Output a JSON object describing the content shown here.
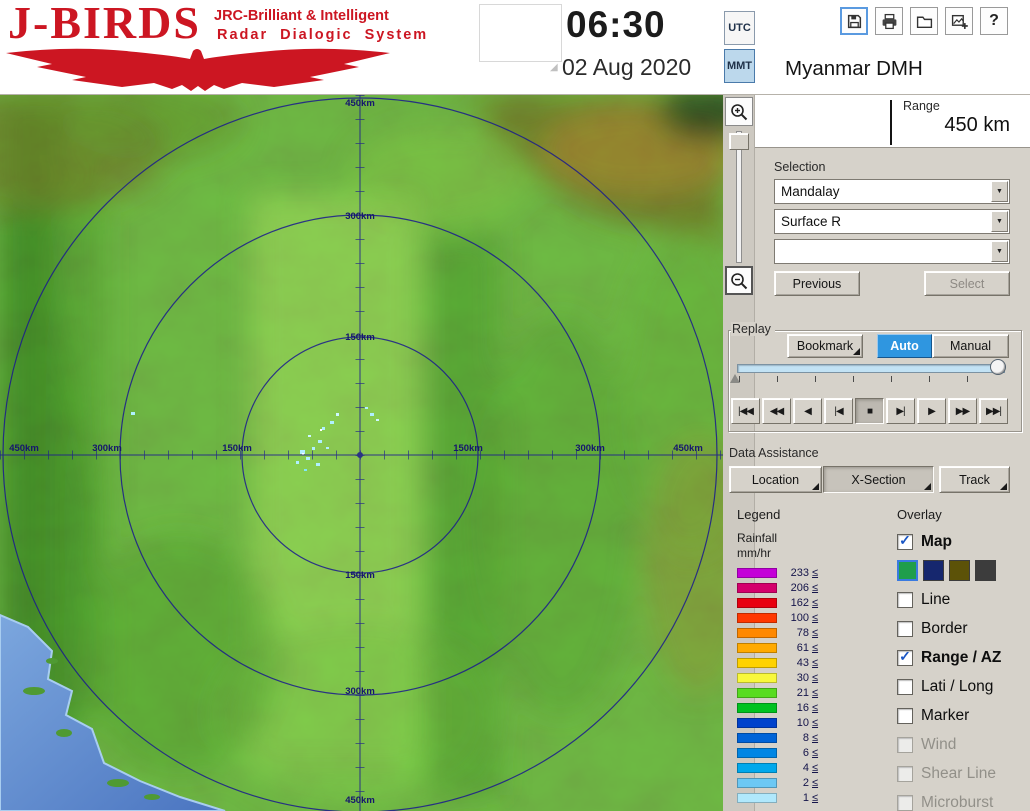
{
  "header": {
    "logo_title": "J-BIRDS",
    "logo_sub1": "JRC-Brilliant & Intelligent",
    "logo_sub2": "Radar  Dialogic  System",
    "time": "06:30",
    "date": "02 Aug 2020",
    "tz_utc": "UTC",
    "tz_mmt": "MMT",
    "tz_selected": "MMT",
    "station": "Myanmar DMH",
    "help_glyph": "?",
    "toolbar_icons": [
      "save",
      "print",
      "open",
      "add-image",
      "help"
    ],
    "brand_color": "#cc1622"
  },
  "range": {
    "label": "Range",
    "value": "450 km"
  },
  "selection": {
    "label": "Selection",
    "dropdown1": "Mandalay",
    "dropdown2": "Surface R",
    "dropdown3": "",
    "previous": "Previous",
    "select": "Select"
  },
  "replay": {
    "label": "Replay",
    "bookmark": "Bookmark",
    "auto": "Auto",
    "manual": "Manual",
    "auto_active_color": "#2f96e0",
    "playback": [
      "|◀◀",
      "◀◀",
      "◀",
      "|◀",
      "■",
      "▶|",
      "▶",
      "▶▶",
      "▶▶|"
    ]
  },
  "data_assistance": {
    "label": "Data Assistance",
    "location": "Location",
    "xsection": "X-Section",
    "track": "Track"
  },
  "legend": {
    "label": "Legend",
    "unit_line1": "Rainfall",
    "unit_line2": "mm/hr",
    "le": "≤",
    "items": [
      {
        "v": "233",
        "c": "#c400d8"
      },
      {
        "v": "206",
        "c": "#d4006c"
      },
      {
        "v": "162",
        "c": "#e80010"
      },
      {
        "v": "100",
        "c": "#ff3800"
      },
      {
        "v": "78",
        "c": "#ff8800"
      },
      {
        "v": "61",
        "c": "#ffaa00"
      },
      {
        "v": "43",
        "c": "#ffd200"
      },
      {
        "v": "30",
        "c": "#f8f83c"
      },
      {
        "v": "21",
        "c": "#58dc20"
      },
      {
        "v": "16",
        "c": "#00c220"
      },
      {
        "v": "10",
        "c": "#0042cc"
      },
      {
        "v": "8",
        "c": "#0064d8"
      },
      {
        "v": "6",
        "c": "#0086e4"
      },
      {
        "v": "4",
        "c": "#00a8ec"
      },
      {
        "v": "2",
        "c": "#6cc8f4"
      },
      {
        "v": "1",
        "c": "#b0e8fc"
      }
    ]
  },
  "overlay": {
    "label": "Overlay",
    "check_color": "#1a56c4",
    "map_swatches": [
      "#1f9e4b",
      "#16276e",
      "#5c5208",
      "#3c3c3c"
    ],
    "items": [
      {
        "label": "Map",
        "check": "✓",
        "enabled": true
      },
      {
        "label": "Line",
        "check": "",
        "enabled": true
      },
      {
        "label": "Border",
        "check": "",
        "enabled": true
      },
      {
        "label": "Range / AZ",
        "check": "✓",
        "enabled": true
      },
      {
        "label": "Lati / Long",
        "check": "",
        "enabled": true
      },
      {
        "label": "Marker",
        "check": "",
        "enabled": true
      },
      {
        "label": "Wind",
        "check": "",
        "enabled": false
      },
      {
        "label": "Shear Line",
        "check": "",
        "enabled": false
      },
      {
        "label": "Microburst",
        "check": "",
        "enabled": false
      }
    ]
  },
  "map": {
    "rings": [
      "150km",
      "300km",
      "450km"
    ]
  }
}
